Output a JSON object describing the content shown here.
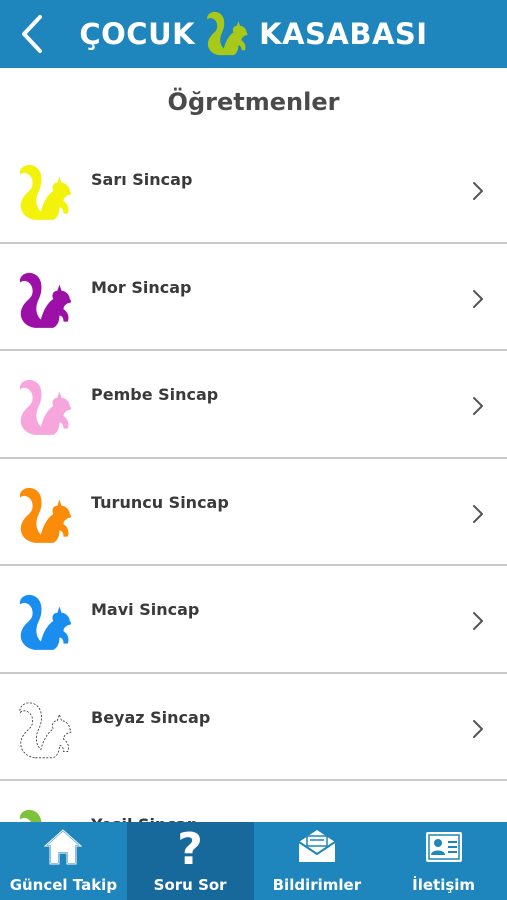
{
  "header": {
    "title_left": "ÇOCUK",
    "title_right": "KASABASI",
    "logo_icon": "squirrel-icon",
    "logo_color": "#a8c81a",
    "back_icon": "chevron-left-icon"
  },
  "page": {
    "title": "Öğretmenler"
  },
  "teachers": [
    {
      "name": "Sarı Sincap",
      "color": "#f2f20a"
    },
    {
      "name": "Mor Sincap",
      "color": "#9c10a8"
    },
    {
      "name": "Pembe Sincap",
      "color": "#f6a6dc"
    },
    {
      "name": "Turuncu Sincap",
      "color": "#fb8c0a"
    },
    {
      "name": "Mavi Sincap",
      "color": "#1a8ef0"
    },
    {
      "name": "Beyaz Sincap",
      "color": "#ffffff"
    },
    {
      "name": "Yeşil Sincap",
      "color": "#7cc23a"
    }
  ],
  "tabs": [
    {
      "label": "Güncel Takip",
      "icon": "home-icon",
      "active": false
    },
    {
      "label": "Soru Sor",
      "icon": "question-icon",
      "active": true
    },
    {
      "label": "Bildirimler",
      "icon": "envelope-icon",
      "active": false
    },
    {
      "label": "İletişim",
      "icon": "contact-card-icon",
      "active": false
    }
  ],
  "colors": {
    "primary": "#1f86bd",
    "tab_active": "#16699a",
    "divider": "#c9c9c9"
  }
}
